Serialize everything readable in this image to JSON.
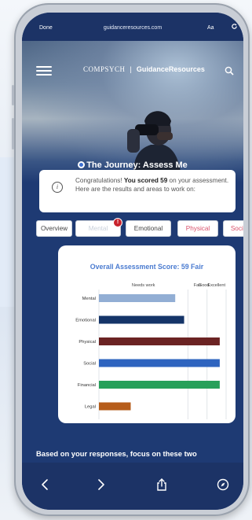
{
  "browser": {
    "done_label": "Done",
    "url": "guidanceresources.com",
    "text_size_label": "Aa"
  },
  "header": {
    "brand_left": "COMPSYCH",
    "brand_right": "GuidanceResources"
  },
  "page": {
    "title": "The Journey: Assess Me"
  },
  "congrats": {
    "prefix": "Congratulations! ",
    "bold": "You scored 59",
    "suffix": " on your assessment. Here are the results and areas to work on:"
  },
  "tabs": [
    {
      "label": "Overview"
    },
    {
      "label": "Mental"
    },
    {
      "label": "Emotional"
    },
    {
      "label": "Physical"
    },
    {
      "label": "Social"
    }
  ],
  "alert_badge": "!",
  "chart_data": {
    "type": "bar",
    "orientation": "horizontal",
    "title": "Overall Assessment Score: 59 Fair",
    "zones": [
      "Needs work",
      "Fair",
      "Good",
      "Excellent"
    ],
    "categories": [
      "Mental",
      "Emotional",
      "Physical",
      "Social",
      "Financial",
      "Legal"
    ],
    "values": [
      60,
      67,
      95,
      95,
      95,
      25
    ],
    "colors": [
      "#92aed4",
      "#153468",
      "#6b2323",
      "#2e64bf",
      "#27a05a",
      "#b65d1b"
    ],
    "xlim": [
      0,
      100
    ],
    "zone_boundaries": [
      0,
      70,
      85,
      100
    ]
  },
  "focus": {
    "text": "Based on your responses, focus on these two"
  },
  "toolbar": {
    "icons": [
      "back-icon",
      "forward-icon",
      "share-icon",
      "compass-icon"
    ]
  }
}
